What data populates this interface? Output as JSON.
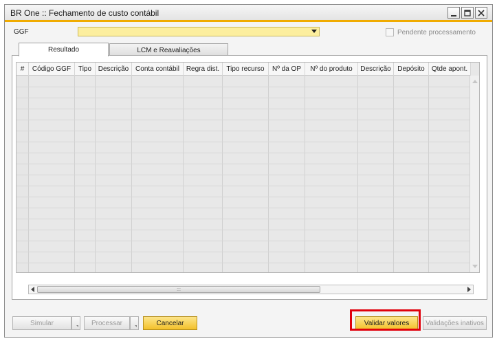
{
  "window": {
    "title": "BR One :: Fechamento de custo contábil"
  },
  "form": {
    "ggf_label": "GGF",
    "ggf_value": "",
    "pending_label": "Pendente processamento",
    "pending_checked": false
  },
  "tabs": [
    {
      "label": "Resultado",
      "active": true
    },
    {
      "label": "LCM e Reavaliações",
      "active": false
    }
  ],
  "grid": {
    "columns": [
      "#",
      "Código GGF",
      "Tipo",
      "Descrição",
      "Conta contábil",
      "Regra dist.",
      "Tipo recurso",
      "Nº da OP",
      "Nº do produto",
      "Descrição",
      "Depósito",
      "Qtde apont."
    ],
    "rows": []
  },
  "buttons": {
    "simular": "Simular",
    "processar": "Processar",
    "cancelar": "Cancelar",
    "validar": "Validar valores",
    "validacoes": "Validações inativos"
  },
  "colors": {
    "accent": "#f0ab00",
    "field_yellow": "#fcee9e",
    "highlight_red": "#e0000b"
  }
}
